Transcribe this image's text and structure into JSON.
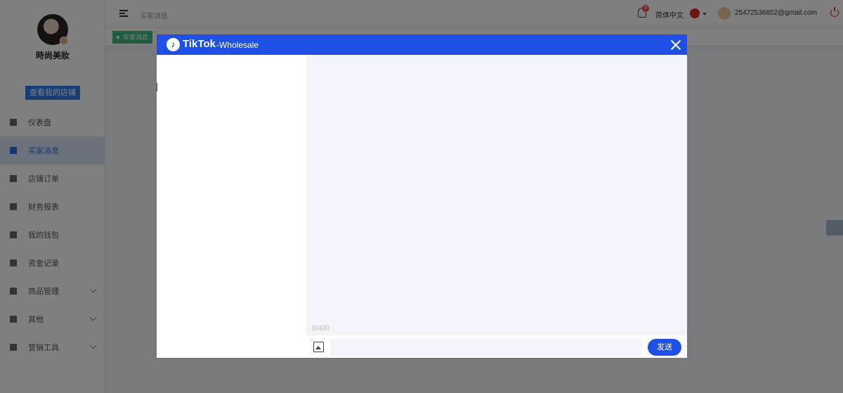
{
  "sidebar": {
    "shop_name": "時尚美妝",
    "view_shop_label": "查看我的店铺",
    "items": [
      {
        "label": "仪表盘",
        "icon": "dashboard-icon",
        "active": false
      },
      {
        "label": "买家消息",
        "icon": "message-icon",
        "active": true
      },
      {
        "label": "店铺订单",
        "icon": "clipboard-icon",
        "active": false
      },
      {
        "label": "财务报表",
        "icon": "chart-icon",
        "active": false
      },
      {
        "label": "我的钱包",
        "icon": "wallet-icon",
        "active": false
      },
      {
        "label": "资金记录",
        "icon": "record-icon",
        "active": false
      },
      {
        "label": "商品管理",
        "icon": "briefcase-icon",
        "active": false,
        "expandable": true
      },
      {
        "label": "其他",
        "icon": "grid-icon",
        "active": false,
        "expandable": true
      },
      {
        "label": "营销工具",
        "icon": "bar-chart-icon",
        "active": false,
        "expandable": true
      }
    ]
  },
  "header": {
    "breadcrumb": "买家消息",
    "notification_count": "5",
    "language": "简体中文",
    "email": "25472536852@gmail.com"
  },
  "tags": {
    "active_tag": "买家消息"
  },
  "modal": {
    "brand": "TikTok",
    "subtitle": "-Wholesale",
    "char_counter": "0/400",
    "input_placeholder": "",
    "send_label": "发送"
  },
  "colors": {
    "primary": "#1e50e6",
    "tag_green": "#42b983",
    "sidebar_active_bg": "#d6e4f8"
  }
}
